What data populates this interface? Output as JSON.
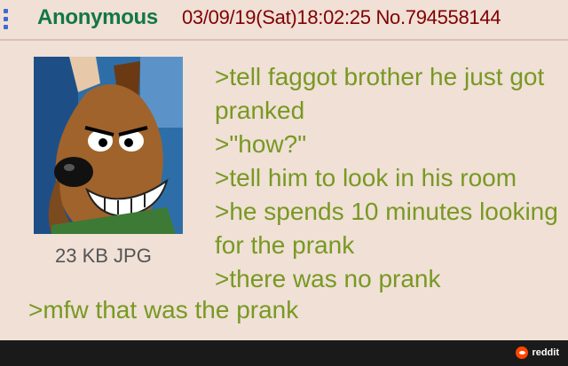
{
  "post": {
    "name": "Anonymous",
    "datetime": "03/09/19(Sat)18:02:25",
    "number": "No.794558144",
    "file_info": "23 KB JPG",
    "lines": [
      ">tell faggot brother he just got pranked",
      ">\"how?\"",
      ">tell him to look in his room",
      ">he spends 10 minutes looking for the prank",
      ">there was no prank"
    ],
    "last_line": ">mfw that was the prank"
  },
  "footer": {
    "brand_label": "reddit",
    "brand_icon": "reddit-icon"
  },
  "colors": {
    "background": "#f0e0d6",
    "name": "#117743",
    "meta": "#800000",
    "greentext": "#789922",
    "footer": "#1a1a1a",
    "reddit": "#ff4500"
  }
}
